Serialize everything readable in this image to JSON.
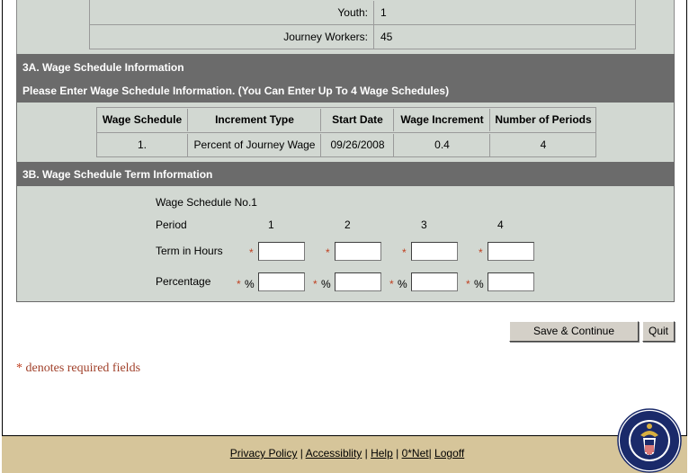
{
  "counts": [
    {
      "label": "Youth:",
      "value": "1"
    },
    {
      "label": "Journey Workers:",
      "value": "45"
    }
  ],
  "section3a": {
    "heading": "3A.   Wage Schedule Information",
    "subheading": "Please Enter Wage Schedule Information. (You Can Enter Up To 4 Wage Schedules)"
  },
  "wage_table": {
    "headers": [
      "Wage Schedule",
      "Increment Type",
      "Start Date",
      "Wage Increment",
      "Number of Periods"
    ],
    "row": [
      "1.",
      "Percent of Journey Wage",
      "09/26/2008",
      "0.4",
      "4"
    ]
  },
  "section3b": {
    "heading": "3B.   Wage Schedule Term Information",
    "schedule_label": "Wage Schedule No.1",
    "period_label": "Period",
    "periods": [
      "1",
      "2",
      "3",
      "4"
    ],
    "term_label": "Term in Hours",
    "percentage_label": "Percentage",
    "required_mark": "*",
    "percent_sign": "%",
    "term_values": [
      "",
      "",
      "",
      ""
    ],
    "percentage_values": [
      "",
      "",
      "",
      ""
    ]
  },
  "buttons": {
    "save": "Save & Continue",
    "quit": "Quit"
  },
  "required_note": {
    "star": "*",
    "text": " denotes required fields"
  },
  "footer": {
    "links": [
      "Privacy Policy",
      "Accessiblity",
      "Help",
      "0*Net",
      "Logoff"
    ],
    "separators": [
      " | ",
      " | ",
      " | ",
      "| "
    ]
  },
  "seal": {
    "top_text": "DEPARTMENT OF LABOR",
    "bottom_text": "UNITED STATES OF AMERICA"
  },
  "colors": {
    "panel_bg": "#d2d8d2",
    "section_header": "#6b6b6b",
    "footer_bg": "#d6c59a",
    "required": "#c04020"
  }
}
